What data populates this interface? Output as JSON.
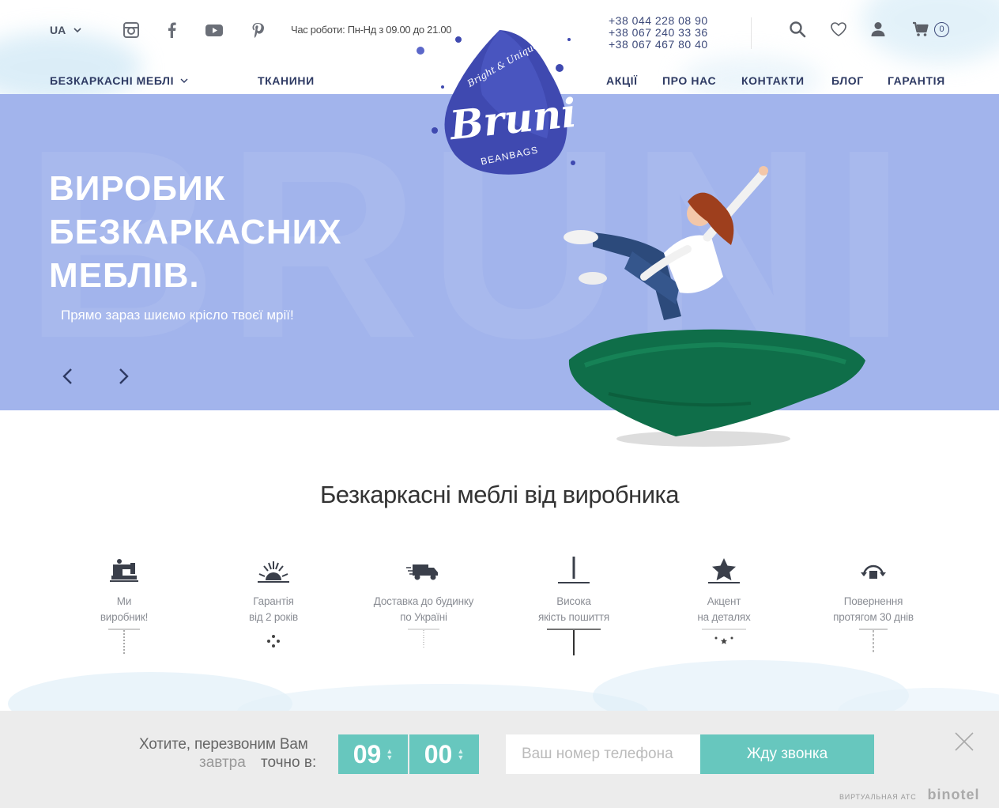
{
  "header": {
    "lang": "UA",
    "hours": "Час роботи: Пн-Нд з 09.00 до 21.00",
    "phones": [
      "+38 044 228 08 90",
      "+38 067 240 33 36",
      "+38 067 467 80 40"
    ],
    "cart_count": "0",
    "social_icons": [
      "instagram-icon",
      "facebook-icon",
      "youtube-icon",
      "pinterest-icon"
    ]
  },
  "nav": {
    "furniture": "БЕЗКАРКАСНІ МЕБЛІ",
    "fabrics": "ТКАНИНИ",
    "sales": "АКЦІЇ",
    "about": "ПРО НАС",
    "contacts": "КОНТАКТИ",
    "blog": "БЛОГ",
    "warranty": "ГАРАНТІЯ"
  },
  "logo": {
    "name": "Bruni",
    "tagline": "Bright & Unique",
    "sub": "BEANBAGS"
  },
  "hero": {
    "title_lines": [
      "ВИРОБИК",
      "БЕЗКАРКАСНИХ",
      "МЕБЛІВ."
    ],
    "subtitle": "Прямо зараз шиємо крісло твоєї мрії!",
    "watermark": "BRUNI",
    "bg_color": "#a2b4ec"
  },
  "features": {
    "title": "Безкаркасні меблі від виробника",
    "items": [
      {
        "line1": "Ми",
        "line2": "виробник!",
        "icon": "sewing-machine-icon"
      },
      {
        "line1": "Гарантія",
        "line2": "від 2 років",
        "icon": "sunrise-icon"
      },
      {
        "line1": "Доставка до будинку",
        "line2": "по Україні",
        "icon": "delivery-truck-icon"
      },
      {
        "line1": "Висока",
        "line2": "якість пошиття",
        "icon": "needle-icon"
      },
      {
        "line1": "Акцент",
        "line2": "на деталях",
        "icon": "star-icon"
      },
      {
        "line1": "Повернення",
        "line2": "протягом 30 днів",
        "icon": "return-box-icon"
      }
    ]
  },
  "callback": {
    "question": "Хотите, перезвоним Вам",
    "day": "завтра",
    "at": "точно в:",
    "hour": "09",
    "minute": "00",
    "phone_placeholder": "Ваш номер телефона",
    "button": "Жду звонка",
    "provider_small": "ВИРТУАЛЬНАЯ АТС",
    "provider": "binotel",
    "accent": "#67c7be"
  }
}
